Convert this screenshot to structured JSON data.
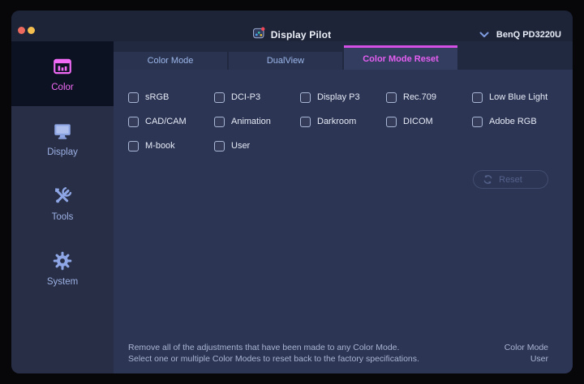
{
  "titlebar": {
    "app_title": "Display Pilot",
    "device_name": "BenQ PD3220U"
  },
  "tabs": [
    {
      "label": "Color Mode",
      "active": false
    },
    {
      "label": "DualView",
      "active": false
    },
    {
      "label": "Color Mode Reset",
      "active": true
    }
  ],
  "sidebar": {
    "items": [
      {
        "label": "Color",
        "icon": "color-modes-icon",
        "active": true
      },
      {
        "label": "Display",
        "icon": "monitor-icon",
        "active": false
      },
      {
        "label": "Tools",
        "icon": "tools-icon",
        "active": false
      },
      {
        "label": "System",
        "icon": "gear-icon",
        "active": false
      }
    ]
  },
  "panel": {
    "color_modes": [
      "sRGB",
      "DCI-P3",
      "Display P3",
      "Rec.709",
      "Low Blue Light",
      "CAD/CAM",
      "Animation",
      "Darkroom",
      "DICOM",
      "Adobe RGB",
      "M-book",
      "User"
    ],
    "checkboxes_checked": false,
    "reset_button": {
      "label": "Reset",
      "enabled": false
    },
    "footer": {
      "description_line1": "Remove all of the adjustments that have been made to any Color Mode.",
      "description_line2": "Select one or multiple Color Modes to reset back to the factory specifications.",
      "status_label": "Color Mode",
      "status_value": "User"
    }
  },
  "colors": {
    "accent_magenta": "#e55ef2",
    "tab_active_border": "#d44fe3",
    "sidebar_icon_blue": "#8ea6e6",
    "traffic_red": "#ed6a5e",
    "traffic_yellow": "#f5bf4f"
  }
}
